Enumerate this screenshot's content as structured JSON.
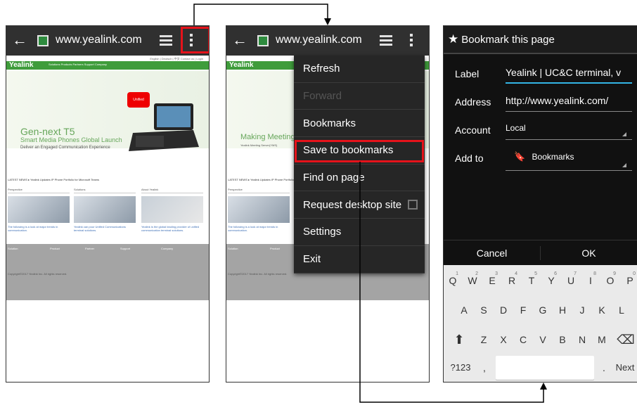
{
  "browser": {
    "url": "www.yealink.com"
  },
  "site": {
    "toplinks": "English | Deutsch | 中文    Contact us | Login",
    "logo": "Yealink",
    "nav": "Solutions      Products      Partners      Support      Company",
    "hero_title": "Gen-next T5",
    "hero_subtitle": "Smart Media Phones Global Launch",
    "hero_tagline": "Deliver an Engaged Communication Experience",
    "badge": "Unified",
    "hero_title_alt": "Making Meeting S",
    "hero_sub_alt": "Yealink Meeting Server(YMS)",
    "news": "LATEST NEWS  ▸  Yealink Updates IP Phone Portfolio for Microsoft Teams",
    "columns": [
      {
        "heading": "Perspective",
        "text": "The following is a look at major trends in communication."
      },
      {
        "heading": "Solutions",
        "text": "Yealink can pour Unified Communications terminal solutions."
      },
      {
        "heading": "About Yealink",
        "text": "Yealink is the global leading provider of unified communication terminal solutions."
      }
    ],
    "footer_cols": [
      "Solution",
      "Product",
      "Partner",
      "Support",
      "Company"
    ],
    "copyright": "Copyright©2017 Yealink Inc. All rights reserved."
  },
  "menu": {
    "items": [
      {
        "label": "Refresh",
        "disabled": false
      },
      {
        "label": "Forward",
        "disabled": true
      },
      {
        "label": "Bookmarks",
        "disabled": false
      },
      {
        "label": "Save to bookmarks",
        "disabled": false
      },
      {
        "label": "Find on page",
        "disabled": false
      },
      {
        "label": "Request desktop site",
        "disabled": false
      },
      {
        "label": "Settings",
        "disabled": false
      },
      {
        "label": "Exit",
        "disabled": false
      }
    ]
  },
  "dialog": {
    "title": "Bookmark this page",
    "label_label": "Label",
    "label_value": "Yealink | UC&C terminal, v",
    "address_label": "Address",
    "address_value": "http://www.yealink.com/",
    "account_label": "Account",
    "account_value": "Local",
    "addto_label": "Add to",
    "addto_value": "Bookmarks",
    "cancel": "Cancel",
    "ok": "OK"
  },
  "keyboard": {
    "row1": [
      [
        "Q",
        "1"
      ],
      [
        "W",
        "2"
      ],
      [
        "E",
        "3"
      ],
      [
        "R",
        "4"
      ],
      [
        "T",
        "5"
      ],
      [
        "Y",
        "6"
      ],
      [
        "U",
        "7"
      ],
      [
        "I",
        "8"
      ],
      [
        "O",
        "9"
      ],
      [
        "P",
        "0"
      ]
    ],
    "row2": [
      "A",
      "S",
      "D",
      "F",
      "G",
      "H",
      "J",
      "K",
      "L"
    ],
    "row3": [
      "Z",
      "X",
      "C",
      "V",
      "B",
      "N",
      "M"
    ],
    "shift": "⬆",
    "backspace": "⌫",
    "symbols": "?123",
    "comma": ",",
    "period": ".",
    "next": "Next"
  },
  "colors": {
    "highlight": "#e5131b",
    "brand_green": "#3f9c3b",
    "dialog_accent": "#33b5e5"
  }
}
